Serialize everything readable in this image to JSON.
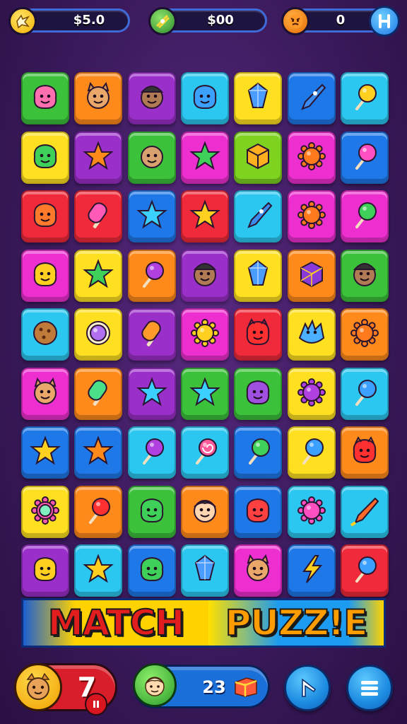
{
  "hud": {
    "coins": "$5.0",
    "gems": "$00",
    "score": "0"
  },
  "colors": {
    "green": "#3cc13b",
    "orange": "#ff8a1c",
    "purple": "#9b2fc9",
    "cyan": "#2cc7f0",
    "yellow": "#ffe020",
    "blue": "#1f78e8",
    "magenta": "#ee2fd0",
    "red": "#f02a3a",
    "lime": "#7ed321"
  },
  "board": {
    "rows": [
      [
        {
          "color": "green",
          "icon": "pink-monster-icon"
        },
        {
          "color": "orange",
          "icon": "cat-face-icon"
        },
        {
          "color": "purple",
          "icon": "hat-face-icon"
        },
        {
          "color": "cyan",
          "icon": "blue-blob-icon"
        },
        {
          "color": "yellow",
          "icon": "blue-gem-icon"
        },
        {
          "color": "blue",
          "icon": "blue-rocket-icon"
        },
        {
          "color": "cyan",
          "icon": "yellow-lollipop-icon"
        }
      ],
      [
        {
          "color": "yellow",
          "icon": "green-blob-icon"
        },
        {
          "color": "purple",
          "icon": "orange-star-icon"
        },
        {
          "color": "green",
          "icon": "bald-face-icon"
        },
        {
          "color": "magenta",
          "icon": "green-star-icon"
        },
        {
          "color": "lime",
          "icon": "cube-icon"
        },
        {
          "color": "magenta",
          "icon": "orange-sun-icon"
        },
        {
          "color": "blue",
          "icon": "pink-lollipop-icon"
        }
      ],
      [
        {
          "color": "red",
          "icon": "orange-blob-icon"
        },
        {
          "color": "red",
          "icon": "pink-popsicle-icon"
        },
        {
          "color": "blue",
          "icon": "cyan-star-icon"
        },
        {
          "color": "red",
          "icon": "yellow-star-icon"
        },
        {
          "color": "cyan",
          "icon": "blue-rocket-icon"
        },
        {
          "color": "magenta",
          "icon": "orange-sun-icon"
        },
        {
          "color": "magenta",
          "icon": "green-lollipop-icon"
        }
      ],
      [
        {
          "color": "magenta",
          "icon": "yellow-blob-icon"
        },
        {
          "color": "yellow",
          "icon": "green-star-icon"
        },
        {
          "color": "orange",
          "icon": "purple-lollipop-icon"
        },
        {
          "color": "purple",
          "icon": "hat-face-icon"
        },
        {
          "color": "yellow",
          "icon": "blue-gem-icon"
        },
        {
          "color": "orange",
          "icon": "gem-cube-icon"
        },
        {
          "color": "green",
          "icon": "hat-face-icon"
        }
      ],
      [
        {
          "color": "cyan",
          "icon": "cookie-icon"
        },
        {
          "color": "yellow",
          "icon": "purple-orb-icon"
        },
        {
          "color": "purple",
          "icon": "orange-popsicle-icon"
        },
        {
          "color": "magenta",
          "icon": "yellow-sun-icon"
        },
        {
          "color": "red",
          "icon": "red-monster-icon"
        },
        {
          "color": "yellow",
          "icon": "blue-dragon-icon"
        },
        {
          "color": "orange",
          "icon": "orange-sun-icon"
        }
      ],
      [
        {
          "color": "magenta",
          "icon": "cat-face-icon"
        },
        {
          "color": "orange",
          "icon": "green-popsicle-icon"
        },
        {
          "color": "purple",
          "icon": "cyan-star-icon"
        },
        {
          "color": "green",
          "icon": "cyan-star-icon"
        },
        {
          "color": "green",
          "icon": "purple-blob-icon"
        },
        {
          "color": "yellow",
          "icon": "purple-sun-icon"
        },
        {
          "color": "cyan",
          "icon": "blue-lollipop-icon"
        }
      ],
      [
        {
          "color": "blue",
          "icon": "yellow-star-icon"
        },
        {
          "color": "blue",
          "icon": "orange-star-icon"
        },
        {
          "color": "cyan",
          "icon": "purple-lollipop-icon"
        },
        {
          "color": "cyan",
          "icon": "swirl-lollipop-icon"
        },
        {
          "color": "blue",
          "icon": "green-lollipop-icon"
        },
        {
          "color": "yellow",
          "icon": "blue-lollipop-icon"
        },
        {
          "color": "orange",
          "icon": "red-monster-icon"
        }
      ],
      [
        {
          "color": "yellow",
          "icon": "gem-ring-icon"
        },
        {
          "color": "orange",
          "icon": "red-lollipop-icon"
        },
        {
          "color": "green",
          "icon": "green-blob-icon"
        },
        {
          "color": "orange",
          "icon": "boy-face-icon"
        },
        {
          "color": "blue",
          "icon": "red-blob-icon"
        },
        {
          "color": "cyan",
          "icon": "pink-sun-icon"
        },
        {
          "color": "cyan",
          "icon": "rocket-icon"
        }
      ],
      [
        {
          "color": "purple",
          "icon": "yellow-blob-icon"
        },
        {
          "color": "cyan",
          "icon": "yellow-star-icon"
        },
        {
          "color": "blue",
          "icon": "green-blob-icon"
        },
        {
          "color": "cyan",
          "icon": "blue-gem-icon"
        },
        {
          "color": "magenta",
          "icon": "cat-face-icon"
        },
        {
          "color": "blue",
          "icon": "yellow-bolt-icon"
        },
        {
          "color": "red",
          "icon": "blue-lollipop-icon"
        }
      ]
    ]
  },
  "title": {
    "word1": "MATCH",
    "word2": "PUZZ!E"
  },
  "footer": {
    "lives": "7",
    "moves": "23"
  }
}
